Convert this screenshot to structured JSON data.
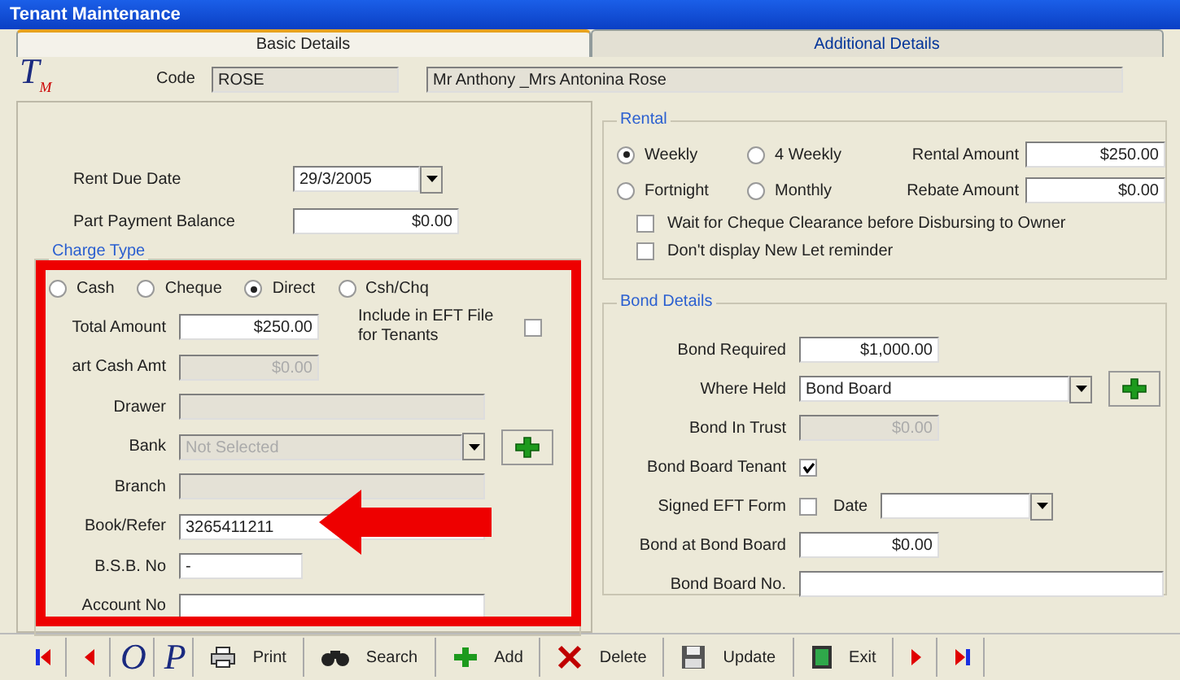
{
  "window": {
    "title": "Tenant Maintenance"
  },
  "tabs": [
    {
      "label": "Basic Details",
      "selected": true
    },
    {
      "label": "Additional Details",
      "selected": false
    }
  ],
  "header": {
    "logo": "T$_{M}$",
    "code_label": "Code",
    "code": "ROSE",
    "name": "Mr Anthony _Mrs Antonina Rose"
  },
  "payment": [
    {
      "kind": "date",
      "label": "Rent Due Date",
      "value": "29/3/2005"
    },
    {
      "kind": "amount",
      "label": "Part Payment Balance",
      "value": "$0.00"
    }
  ],
  "charge_type": {
    "legend": "Charge Type",
    "options": [
      {
        "label": "Cash",
        "selected": false
      },
      {
        "label": "Cheque",
        "selected": false
      },
      {
        "label": "Direct",
        "selected": true
      },
      {
        "label": "Csh/Chq",
        "selected": false
      }
    ],
    "eft": {
      "label": "Include in EFT File for Tenants",
      "checked": false
    },
    "fields": [
      {
        "kind": "amount",
        "label": "Total Amount",
        "value": "$250.00",
        "disabled": false
      },
      {
        "kind": "amount",
        "label": "art Cash Amt",
        "value": "$0.00",
        "disabled": true
      },
      {
        "kind": "text",
        "label": "Drawer",
        "disabled": true
      },
      {
        "kind": "combo",
        "label": "Bank",
        "value": "Not Selected",
        "disabled": true,
        "add_button": true
      },
      {
        "kind": "text",
        "label": "Branch",
        "disabled": true
      },
      {
        "kind": "text",
        "label": "Book/Refer",
        "value": "3265411211",
        "disabled": false
      },
      {
        "kind": "short",
        "label": "B.S.B. No",
        "value": "-",
        "disabled": false
      },
      {
        "kind": "text",
        "label": "Account No",
        "disabled": false
      }
    ]
  },
  "rental": {
    "legend": "Rental",
    "frequencies": [
      {
        "label": "Weekly",
        "selected": true
      },
      {
        "label": "4 Weekly",
        "selected": false
      },
      {
        "label": "Fortnight",
        "selected": false
      },
      {
        "label": "Monthly",
        "selected": false
      }
    ],
    "amounts": [
      {
        "label": "Rental Amount",
        "value": "$250.00"
      },
      {
        "label": "Rebate Amount",
        "value": "$0.00"
      }
    ],
    "options": [
      {
        "label": "Wait for Cheque Clearance before Disbursing to Owner",
        "checked": false
      },
      {
        "label": "Don't display New Let reminder",
        "checked": false
      }
    ]
  },
  "bond": {
    "legend": "Bond Details",
    "rows": [
      {
        "kind": "amount",
        "label": "Bond Required",
        "value": "$1,000.00",
        "disabled": false
      },
      {
        "kind": "combo",
        "label": "Where Held",
        "value": "Bond Board",
        "disabled": false,
        "add_button": true
      },
      {
        "kind": "amount",
        "label": "Bond In Trust",
        "value": "$0.00",
        "disabled": true
      },
      {
        "kind": "checkbox",
        "label": "Bond Board Tenant",
        "checked": true
      },
      {
        "kind": "checkbox_date",
        "label": "Signed EFT Form",
        "checked": false,
        "date_label": "Date"
      },
      {
        "kind": "amount",
        "label": "Bond at Bond Board",
        "value": "$0.00",
        "disabled": false
      },
      {
        "kind": "text",
        "label": "Bond Board No.",
        "disabled": false
      }
    ]
  },
  "toolbar": [
    {
      "kind": "first"
    },
    {
      "kind": "previous"
    },
    {
      "kind": "letter",
      "label": "O"
    },
    {
      "kind": "letter",
      "label": "P"
    },
    {
      "kind": "print",
      "label": "Print"
    },
    {
      "kind": "search",
      "label": "Search"
    },
    {
      "kind": "add",
      "label": "Add"
    },
    {
      "kind": "delete",
      "label": "Delete"
    },
    {
      "kind": "update",
      "label": "Update"
    },
    {
      "kind": "exit",
      "label": "Exit"
    },
    {
      "kind": "next"
    },
    {
      "kind": "last"
    }
  ]
}
